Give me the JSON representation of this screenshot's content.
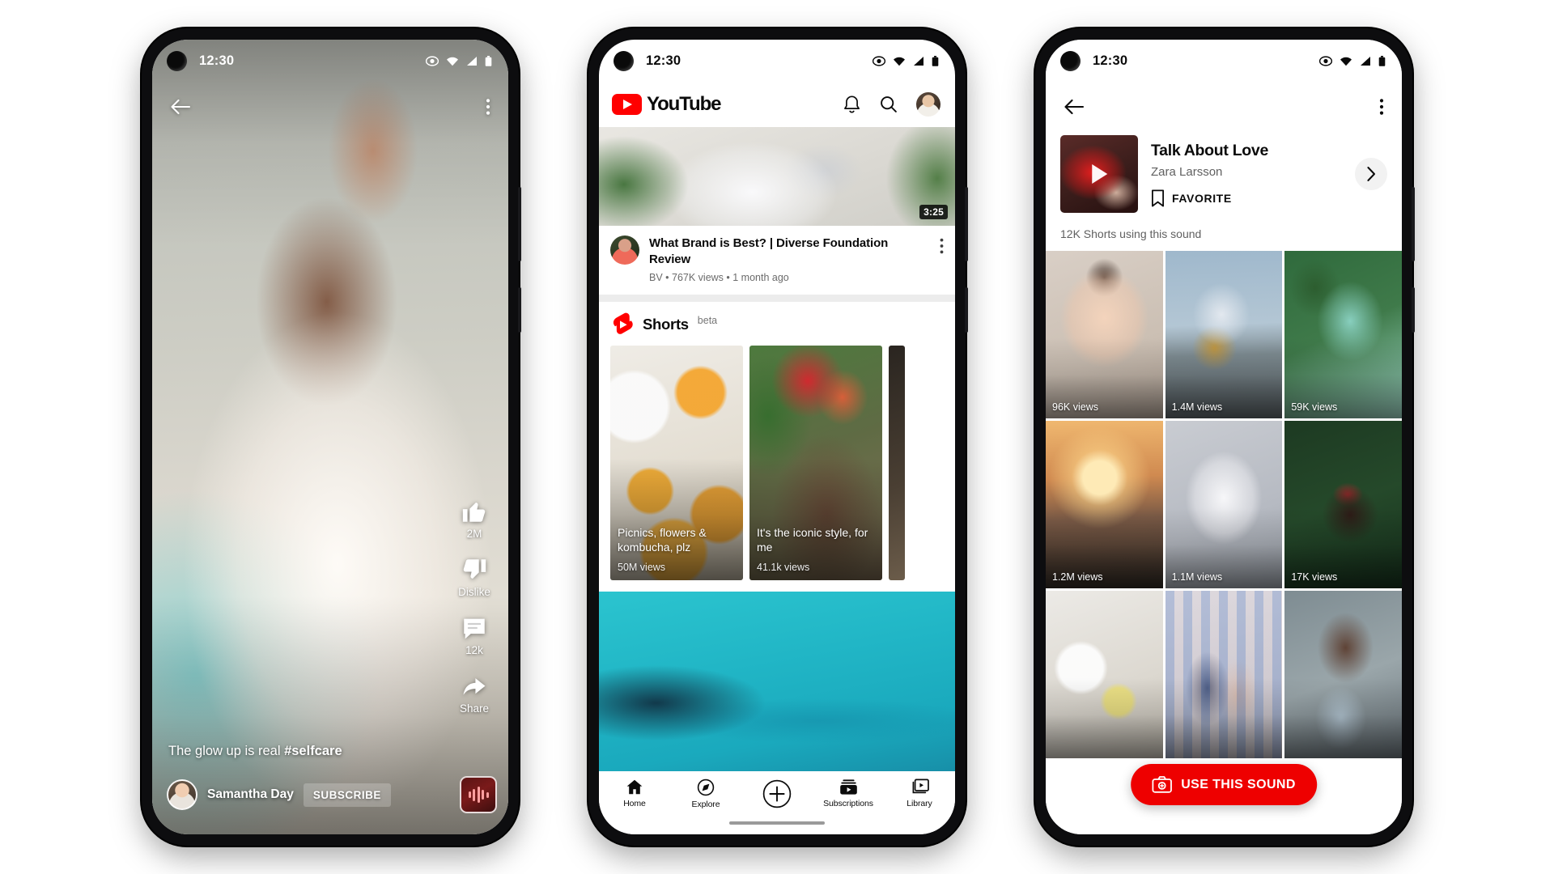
{
  "background_color": "#ffffff",
  "brand": {
    "youtube_red": "#ff0000",
    "cta_red": "#ee0000"
  },
  "status_bar": {
    "time": "12:30",
    "icons": [
      "eye-icon",
      "wifi-icon",
      "signal-icon",
      "battery-icon"
    ]
  },
  "phone1": {
    "name": "shorts-player",
    "topbar": {
      "back_icon": "back-arrow-icon",
      "menu_icon": "kebab-menu-icon"
    },
    "actions": [
      {
        "icon": "thumbs-up-icon",
        "label": "2M"
      },
      {
        "icon": "thumbs-down-icon",
        "label": "Dislike"
      },
      {
        "icon": "comment-icon",
        "label": "12k"
      },
      {
        "icon": "share-icon",
        "label": "Share"
      }
    ],
    "caption": {
      "text": "The glow up is real ",
      "hashtag": "#selfcare"
    },
    "channel": {
      "name": "Samantha Day",
      "avatar": "channel-avatar"
    },
    "subscribe_label": "SUBSCRIBE",
    "sound_button": "sound-waveform-icon"
  },
  "phone2": {
    "name": "youtube-home",
    "header": {
      "wordmark": "YouTube",
      "logo_icon": "youtube-play-logo",
      "notifications_icon": "bell-icon",
      "search_icon": "search-icon",
      "profile_icon": "profile-avatar"
    },
    "video": {
      "duration": "3:25",
      "title": "What Brand is Best? | Diverse Foundation Review",
      "meta": "BV •  767K views • 1 month ago",
      "menu_icon": "kebab-menu-icon"
    },
    "shorts_shelf": {
      "logo_icon": "shorts-logo-icon",
      "title": "Shorts",
      "badge": "beta",
      "cards": [
        {
          "title": "Picnics, flowers & kombucha, plz",
          "views": "50M views"
        },
        {
          "title": "It's the iconic style, for me",
          "views": "41.1k views"
        }
      ]
    },
    "nav": [
      {
        "icon": "home-icon",
        "label": "Home"
      },
      {
        "icon": "compass-icon",
        "label": "Explore"
      },
      {
        "icon": "plus-circle-icon",
        "label": ""
      },
      {
        "icon": "subscriptions-icon",
        "label": "Subscriptions"
      },
      {
        "icon": "library-icon",
        "label": "Library"
      }
    ]
  },
  "phone3": {
    "name": "sound-detail",
    "topbar": {
      "back_icon": "back-arrow-icon",
      "menu_icon": "kebab-menu-icon"
    },
    "sound": {
      "title": "Talk About Love",
      "artist": "Zara Larsson",
      "favorite_label": "FAVORITE",
      "favorite_icon": "bookmark-icon",
      "chevron_icon": "chevron-right-icon",
      "cover_icon": "play-triangle-icon"
    },
    "count_text": "12K Shorts using this sound",
    "grid": [
      {
        "views": "96K views"
      },
      {
        "views": "1.4M views"
      },
      {
        "views": "59K views"
      },
      {
        "views": "1.2M views"
      },
      {
        "views": "1.1M views"
      },
      {
        "views": "17K views"
      },
      {
        "views": ""
      },
      {
        "views": ""
      },
      {
        "views": ""
      }
    ],
    "cta": {
      "label": "USE THIS SOUND",
      "icon": "camera-icon"
    }
  }
}
